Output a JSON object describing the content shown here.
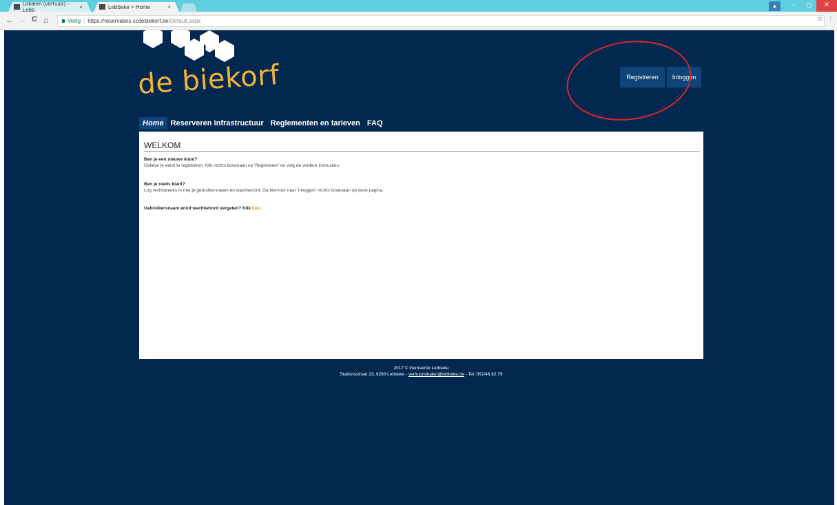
{
  "browser": {
    "tabs": [
      {
        "label": "Lokalen (verhuur) - Lebb"
      },
      {
        "label": "Lebbeke > Home"
      }
    ],
    "tab_close": "×",
    "security_label": "Veilig",
    "url_host": "https://reservaties.ccdebiekorf.be",
    "url_path": "/Default.aspx",
    "back": "←",
    "forward": "→",
    "reload": "C",
    "home": "⌂",
    "star": "☆",
    "menu": "⋮",
    "minimize": "–",
    "maximize": "◻",
    "close": "✕"
  },
  "header": {
    "logo_text": "de biekorf",
    "register_label": "Registreren",
    "login_label": "Inloggen"
  },
  "nav": {
    "items": [
      {
        "label": "Home"
      },
      {
        "label": "Reserveren infrastructuur"
      },
      {
        "label": "Reglementen en tarieven"
      },
      {
        "label": "FAQ"
      }
    ]
  },
  "main": {
    "title": "WELKOM",
    "new_customer_heading": "Ben je een nieuwe klant?",
    "new_customer_text": "Gelieve je eerst te registreren. Klik rechts bovenaan op 'Registreren' en volg de verdere instructies.",
    "existing_customer_heading": "Ben je reeds klant?",
    "existing_customer_text": "Log rechtstreeks in met je gebruikersnaam en wachtwoord. Ga hiervoor naar 'Inloggen' rechts bovenaan op deze pagina.",
    "forgot_text": "Gebruikersnaam en/of wachtwoord vergeten? Klik ",
    "forgot_link": "hier",
    "forgot_end": "."
  },
  "footer": {
    "copyright": "2017 © Gemeente Lebbeke",
    "address": "Stationsstraat 23, 9280 Lebbeke  - ",
    "email": "verhuurlokalen@lebbeke.be",
    "phone": " - Tel: 052/46.82.79"
  },
  "colors": {
    "page_bg": "#02284f",
    "nav_active": "#0f4478",
    "logo": "#f0b43c",
    "highlight_circle": "#d62b2b",
    "link": "#e99a3a"
  }
}
